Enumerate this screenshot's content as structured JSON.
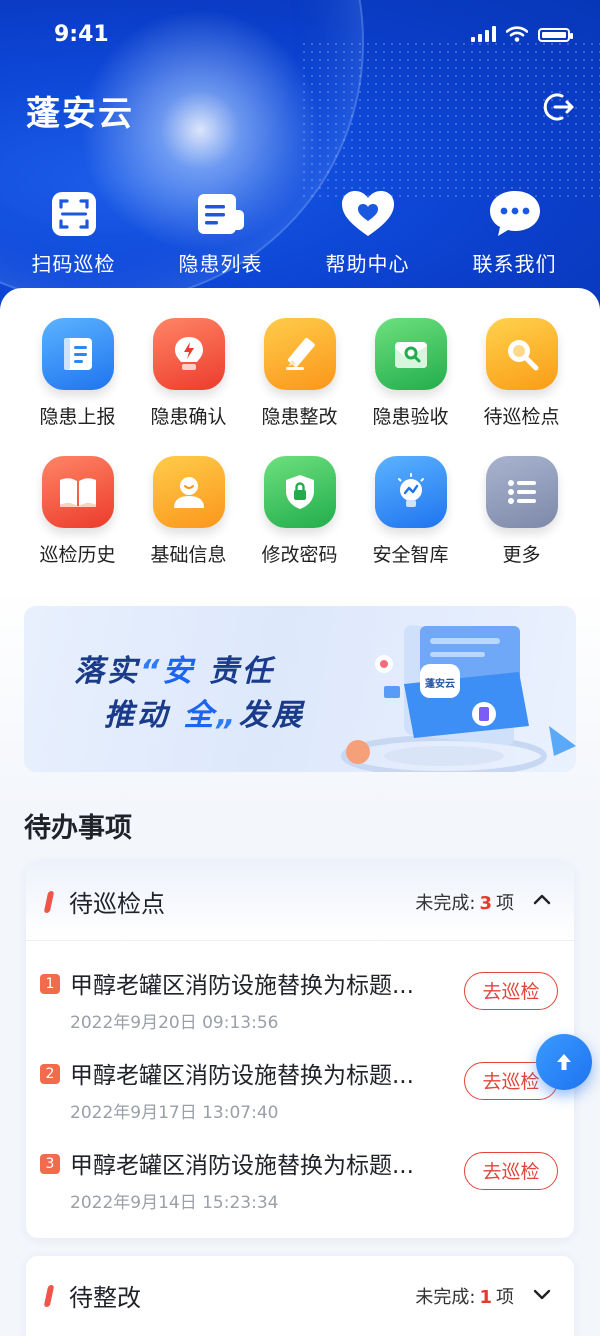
{
  "status_bar": {
    "time": "9:41"
  },
  "app": {
    "title": "蓬安云"
  },
  "top_nav": [
    {
      "label": "扫码巡检",
      "icon": "scan-icon"
    },
    {
      "label": "隐患列表",
      "icon": "list-icon"
    },
    {
      "label": "帮助中心",
      "icon": "heart-icon"
    },
    {
      "label": "联系我们",
      "icon": "chat-icon"
    }
  ],
  "grid": [
    {
      "label": "隐患上报",
      "icon": "report-book-icon",
      "color": "#2f86f5"
    },
    {
      "label": "隐患确认",
      "icon": "lightning-icon",
      "color": "#f2553d"
    },
    {
      "label": "隐患整改",
      "icon": "pencil-icon",
      "color": "#fba91d"
    },
    {
      "label": "隐患验收",
      "icon": "inspect-folder-icon",
      "color": "#2fc05a"
    },
    {
      "label": "待巡检点",
      "icon": "magnifier-icon",
      "color": "#fbb01c"
    },
    {
      "label": "巡检历史",
      "icon": "open-book-icon",
      "color": "#f2553d"
    },
    {
      "label": "基础信息",
      "icon": "user-icon",
      "color": "#fba91d"
    },
    {
      "label": "修改密码",
      "icon": "shield-lock-icon",
      "color": "#2fc05a"
    },
    {
      "label": "安全智库",
      "icon": "bulb-icon",
      "color": "#2f86f5"
    },
    {
      "label": "更多",
      "icon": "more-list-icon",
      "color": "#8a96b4"
    }
  ],
  "banner": {
    "line1_a": "落实",
    "line1_q": "“",
    "line1_hl": "安",
    "line1_b": "责任",
    "line2_a": "推动",
    "line2_hl": "全",
    "line2_q": "„",
    "line2_b": "发展",
    "logo_text": "蓬安云"
  },
  "todo": {
    "section_title": "待办事项",
    "card1": {
      "title": "待巡检点",
      "meta_prefix": "未完成:",
      "count": "3",
      "meta_suffix": "项",
      "items": [
        {
          "num": "1",
          "title": "甲醇老罐区消防设施替换为标题...",
          "time": "2022年9月20日 09:13:56",
          "action": "去巡检"
        },
        {
          "num": "2",
          "title": "甲醇老罐区消防设施替换为标题...",
          "time": "2022年9月17日 13:07:40",
          "action": "去巡检"
        },
        {
          "num": "3",
          "title": "甲醇老罐区消防设施替换为标题...",
          "time": "2022年9月14日 15:23:34",
          "action": "去巡检"
        }
      ]
    },
    "card2": {
      "title": "待整改",
      "meta_prefix": "未完成:",
      "count": "1",
      "meta_suffix": "项"
    }
  }
}
